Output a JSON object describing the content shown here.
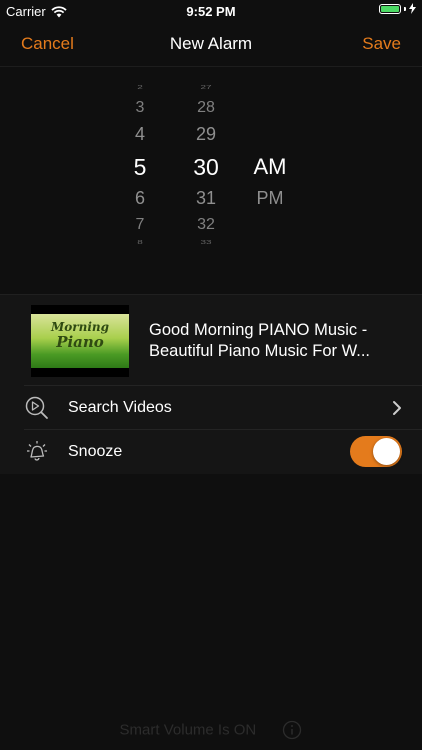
{
  "status_bar": {
    "carrier": "Carrier",
    "time": "9:52 PM"
  },
  "nav": {
    "cancel_label": "Cancel",
    "title": "New Alarm",
    "save_label": "Save",
    "accent_color": "#e47b1c"
  },
  "time_picker": {
    "hours": {
      "far_prev2": "2",
      "far_prev": "3",
      "prev": "4",
      "selected": "5",
      "next": "6",
      "far_next": "7",
      "far_next2": "8"
    },
    "minutes": {
      "far_prev2": "27",
      "far_prev": "28",
      "prev": "29",
      "selected": "30",
      "next": "31",
      "far_next": "32",
      "far_next2": "33"
    },
    "ampm": {
      "selected": "AM",
      "next": "PM"
    }
  },
  "video": {
    "thumbnail_line1": "Morning",
    "thumbnail_line2": "Piano",
    "title_line1": "Good Morning PIANO Music -",
    "title_line2": "Beautiful Piano Music For W..."
  },
  "search_row": {
    "label": "Search Videos",
    "icon": "search-videos-icon"
  },
  "snooze_row": {
    "label": "Snooze",
    "icon": "snooze-bell-icon",
    "enabled": true
  },
  "footer": {
    "smart_volume_text": "Smart Volume Is ON",
    "icon": "info-icon"
  }
}
